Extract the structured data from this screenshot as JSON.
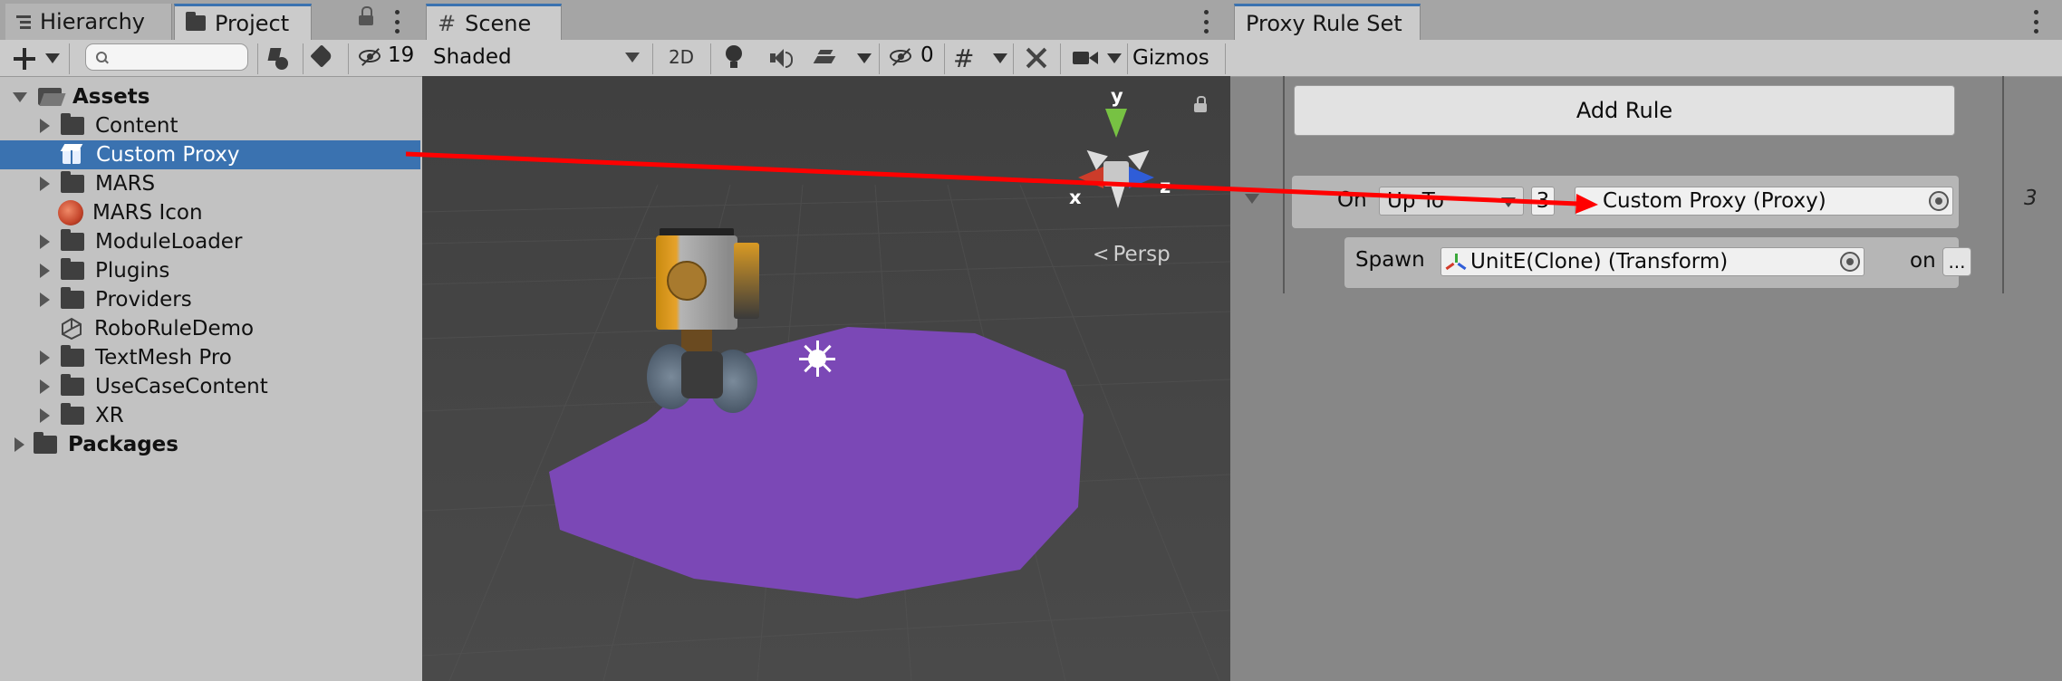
{
  "project_panel": {
    "tabs": [
      {
        "label": "Hierarchy",
        "icon": "hierarchy-list-icon"
      },
      {
        "label": "Project",
        "icon": "folder-icon"
      }
    ],
    "hidden_count": "19",
    "search": {
      "value": "",
      "placeholder": ""
    },
    "tree": [
      {
        "label": "Assets",
        "icon": "open-folder-icon",
        "expanded": true,
        "bold": true
      },
      {
        "label": "Content",
        "icon": "folder-icon"
      },
      {
        "label": "Custom Proxy",
        "icon": "prefab-cube-icon",
        "selected": true
      },
      {
        "label": "MARS",
        "icon": "folder-icon"
      },
      {
        "label": "MARS Icon",
        "icon": "image-thumbnail-icon"
      },
      {
        "label": "ModuleLoader",
        "icon": "folder-icon"
      },
      {
        "label": "Plugins",
        "icon": "folder-icon"
      },
      {
        "label": "Providers",
        "icon": "folder-icon"
      },
      {
        "label": "RoboRuleDemo",
        "icon": "unity-scene-icon"
      },
      {
        "label": "TextMesh Pro",
        "icon": "folder-icon"
      },
      {
        "label": "UseCaseContent",
        "icon": "folder-icon"
      },
      {
        "label": "XR",
        "icon": "folder-icon"
      },
      {
        "label": "Packages",
        "icon": "folder-icon",
        "bold": true
      }
    ]
  },
  "scene_panel": {
    "tab_label": "Scene",
    "shading_mode": "Shaded",
    "mode_2d": "2D",
    "hidden_objects_count": "0",
    "gizmos_label": "Gizmos",
    "gizmo_axes": {
      "x": "x",
      "y": "y",
      "z": "z"
    },
    "projection_label": "Persp",
    "colors": {
      "viewport_bg": "#474747",
      "ground_disc": "#7b48b6"
    }
  },
  "rule_panel": {
    "tab_label": "Proxy Rule Set",
    "add_rule_label": "Add Rule",
    "on_label": "On",
    "condition": "Up To",
    "count": "3",
    "proxy_field": "Custom Proxy (Proxy)",
    "spawn_label": "Spawn",
    "spawn_field": "UnitE(Clone) (Transform)",
    "on_suffix": "on",
    "more_button": "...",
    "side_number": "3"
  },
  "drag_arrow": {
    "color": "#ff0000"
  }
}
